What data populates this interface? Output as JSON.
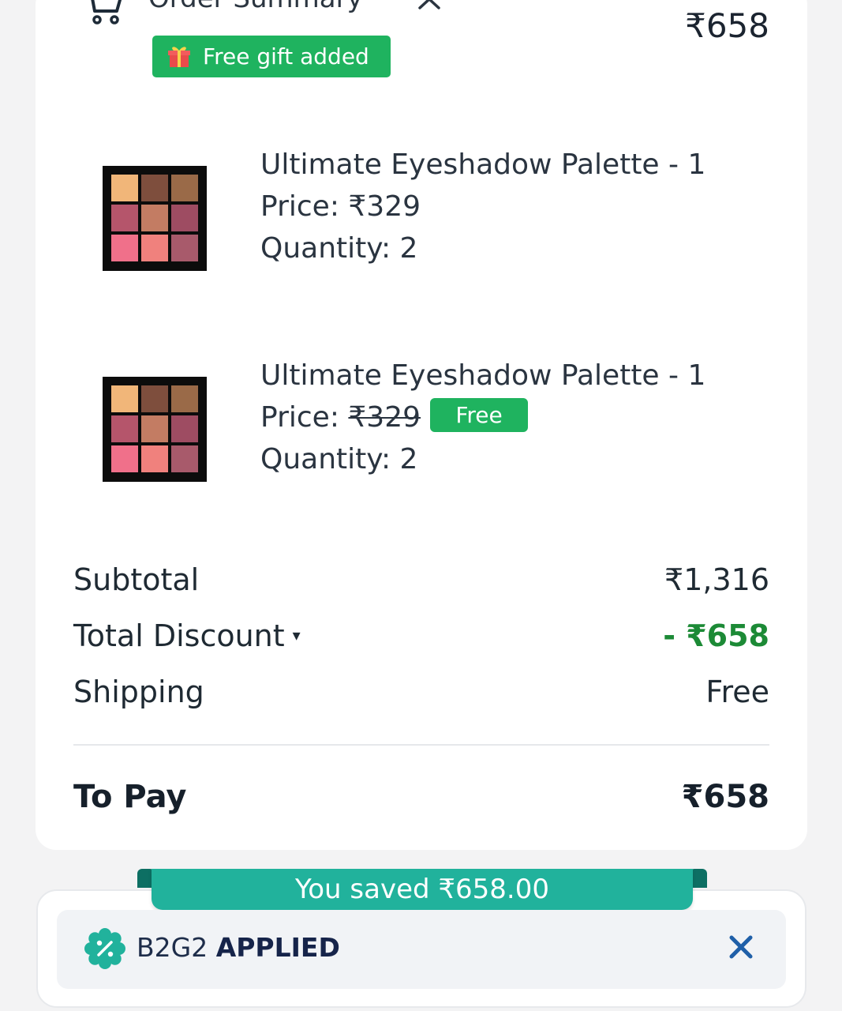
{
  "header": {
    "title": "Order Summary",
    "total": "₹658",
    "gift_badge": "Free gift added"
  },
  "items": [
    {
      "name": "Ultimate Eyeshadow Palette - 1",
      "price_label": "Price: ",
      "price": "₹329",
      "quantity": "Quantity: 2",
      "free": false
    },
    {
      "name": "Ultimate Eyeshadow Palette - 1",
      "price_label": "Price: ",
      "price": "₹329",
      "free_label": "Free",
      "quantity": "Quantity: 2",
      "free": true
    }
  ],
  "summary": {
    "subtotal_label": "Subtotal",
    "subtotal_value": "₹1,316",
    "discount_label": "Total Discount",
    "discount_caret": "▾",
    "discount_value": "- ₹658",
    "shipping_label": "Shipping",
    "shipping_value": "Free",
    "to_pay_label": "To Pay",
    "to_pay_value": "₹658"
  },
  "promo": {
    "saved_text": "You saved ₹658.00",
    "code": "B2G2",
    "status": "APPLIED"
  },
  "colors": {
    "accent_green": "#1fb35f",
    "discount_green": "#1c8a36",
    "teal": "#21b29c"
  },
  "icons": {
    "cart": "cart-icon",
    "toggle": "chevron-up-icon",
    "gift": "gift-icon",
    "coupon": "discount-badge-icon",
    "remove": "close-icon"
  }
}
